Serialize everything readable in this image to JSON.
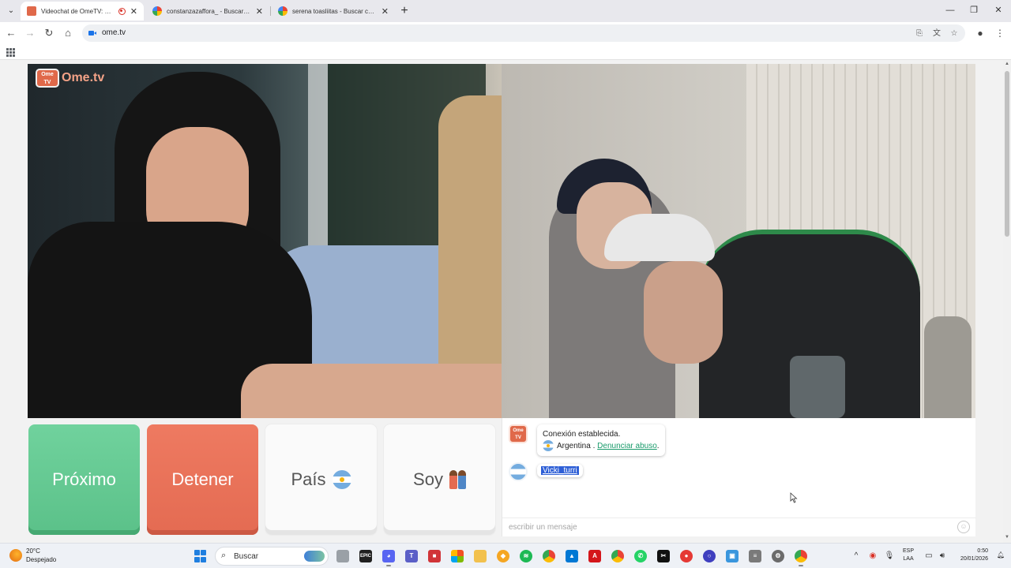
{
  "browser": {
    "tabs": [
      {
        "title": "Videochat de OmeTV: una a",
        "recording": true,
        "active": true
      },
      {
        "title": "constanzazaffora_ - Buscar con",
        "recording": false,
        "active": false
      },
      {
        "title": "serena toasliitas - Buscar con G",
        "recording": false,
        "active": false
      }
    ],
    "url": "ome.tv",
    "colors": {
      "tab_strip": "#e8e8ed",
      "omnibox": "#eef0f3"
    }
  },
  "app": {
    "logo_badge": "Ome TV",
    "logo_text": "Ome.tv",
    "brand_color": "#e0694a"
  },
  "controls": {
    "next_label": "Próximo",
    "stop_label": "Detener",
    "country_label": "País",
    "soy_label": "Soy",
    "next_color": "#5bc189",
    "stop_color": "#e46b52"
  },
  "chat": {
    "system_line1": "Conexión establecida.",
    "country": "Argentina",
    "separator": " . ",
    "report_link": "Denunciar abuso",
    "report_suffix": ".",
    "user_message": "Vicki_turri",
    "input_placeholder": "escribir un mensaje"
  },
  "taskbar": {
    "weather_temp": "20°C",
    "weather_desc": "Despejado",
    "search_label": "Buscar",
    "lang_line1": "ESP",
    "lang_line2": "LAA",
    "time": "0:50",
    "date": "20/01/2026"
  }
}
